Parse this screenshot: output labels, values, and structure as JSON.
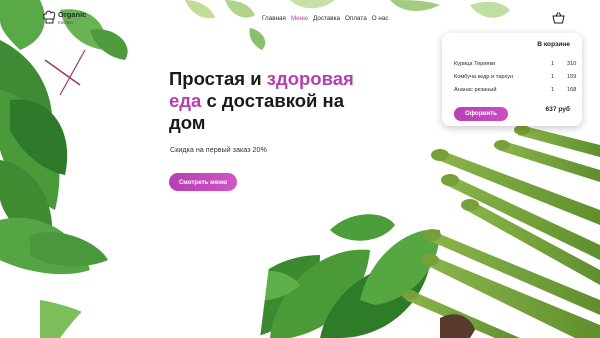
{
  "brand": {
    "name": "Organic",
    "sub": "Kitchen"
  },
  "nav": {
    "items": [
      "Главная",
      "Меню",
      "Доставка",
      "Оплата",
      "О нас"
    ],
    "active_index": 1
  },
  "hero": {
    "title_part1": "Простая и ",
    "title_highlight1": "здоровая еда",
    "title_part2": " с доставкой на дом",
    "subtitle": "Скидка на первый заказ 20%",
    "cta_label": "Смотреть меню"
  },
  "cart": {
    "title": "В корзине",
    "items": [
      {
        "name": "Курица Терияки",
        "qty": "1",
        "price": "310"
      },
      {
        "name": "Комбуча кедр и тархун",
        "qty": "1",
        "price": "159"
      },
      {
        "name": "Ананас резаный",
        "qty": "1",
        "price": "168"
      }
    ],
    "order_label": "Оформить",
    "total": "637 руб"
  },
  "icons": {
    "logo": "chef-hat-icon",
    "cart": "shopping-basket-icon"
  },
  "colors": {
    "accent": "#b93bb0",
    "text": "#1a1a1a",
    "greens": "#2f8a2c"
  }
}
